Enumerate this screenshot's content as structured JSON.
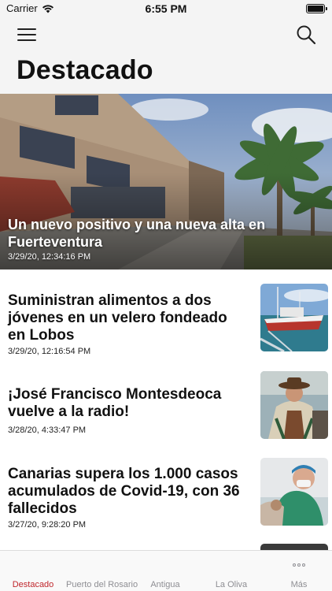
{
  "status_bar": {
    "carrier": "Carrier",
    "time": "6:55 PM"
  },
  "nav": {
    "title": "Destacado"
  },
  "hero": {
    "title": "Un nuevo positivo y una nueva alta en Fuerteventura",
    "date": "3/29/20, 12:34:16 PM"
  },
  "articles": [
    {
      "title": "Suministran alimentos a dos jóvenes en un velero fondeado en Lobos",
      "date": "3/29/20, 12:16:54 PM"
    },
    {
      "title": "¡José Francisco Montesdeoca vuelve a la radio!",
      "date": "3/28/20, 4:33:47 PM"
    },
    {
      "title": "Canarias supera los 1.000 casos acumulados de Covid-19, con 36 fallecidos",
      "date": "3/27/20, 9:28:20 PM"
    }
  ],
  "tabs": [
    {
      "label": "Destacado",
      "active": true
    },
    {
      "label": "Puerto del Rosario"
    },
    {
      "label": "Antigua"
    },
    {
      "label": "La Oliva"
    },
    {
      "label": "Más"
    }
  ],
  "colors": {
    "accent": "#c0272d",
    "inactive_tab": "#8e8e93"
  }
}
